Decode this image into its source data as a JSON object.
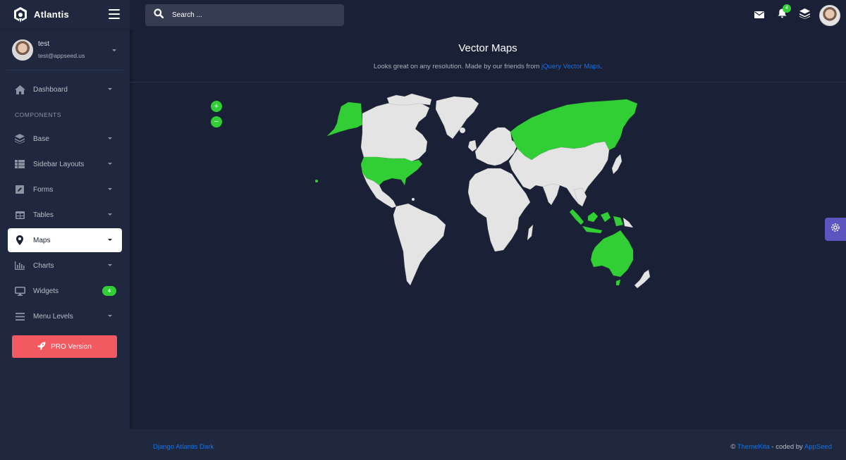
{
  "brand": {
    "name": "Atlantis"
  },
  "user": {
    "name": "test",
    "email": "test@appseed.us"
  },
  "search": {
    "placeholder": "Search ..."
  },
  "topbar": {
    "notification_count": "4"
  },
  "sidebar": {
    "section_title": "COMPONENTS",
    "items": [
      {
        "label": "Dashboard",
        "icon": "home-icon",
        "caret": true
      },
      {
        "label": "Base",
        "icon": "layers-icon",
        "caret": true
      },
      {
        "label": "Sidebar Layouts",
        "icon": "th-list-icon",
        "caret": true
      },
      {
        "label": "Forms",
        "icon": "pen-square-icon",
        "caret": true
      },
      {
        "label": "Tables",
        "icon": "table-icon",
        "caret": true
      },
      {
        "label": "Maps",
        "icon": "map-marker-icon",
        "caret": true,
        "active": true
      },
      {
        "label": "Charts",
        "icon": "chart-bar-icon",
        "caret": true
      },
      {
        "label": "Widgets",
        "icon": "desktop-icon",
        "badge": "4"
      },
      {
        "label": "Menu Levels",
        "icon": "bars-icon",
        "caret": true
      }
    ],
    "pro_button": "PRO Version"
  },
  "page": {
    "title": "Vector Maps",
    "subtitle_prefix": "Looks great on any resolution. Made by our friends from ",
    "subtitle_link": "jQuery Vector Maps",
    "subtitle_suffix": "."
  },
  "map": {
    "zoom_in": "+",
    "zoom_out": "−",
    "highlighted_regions": [
      "United States",
      "Russia",
      "Australia",
      "Indonesia",
      "Papua New Guinea"
    ],
    "highlight_color": "#31ce36",
    "land_color": "#e4e4e4"
  },
  "footer": {
    "left_link": "Django Atlantis Dark",
    "copyright_symbol": "©",
    "themekita": "ThemeKita",
    "coded_by": " - coded by ",
    "appseed": "AppSeed"
  }
}
